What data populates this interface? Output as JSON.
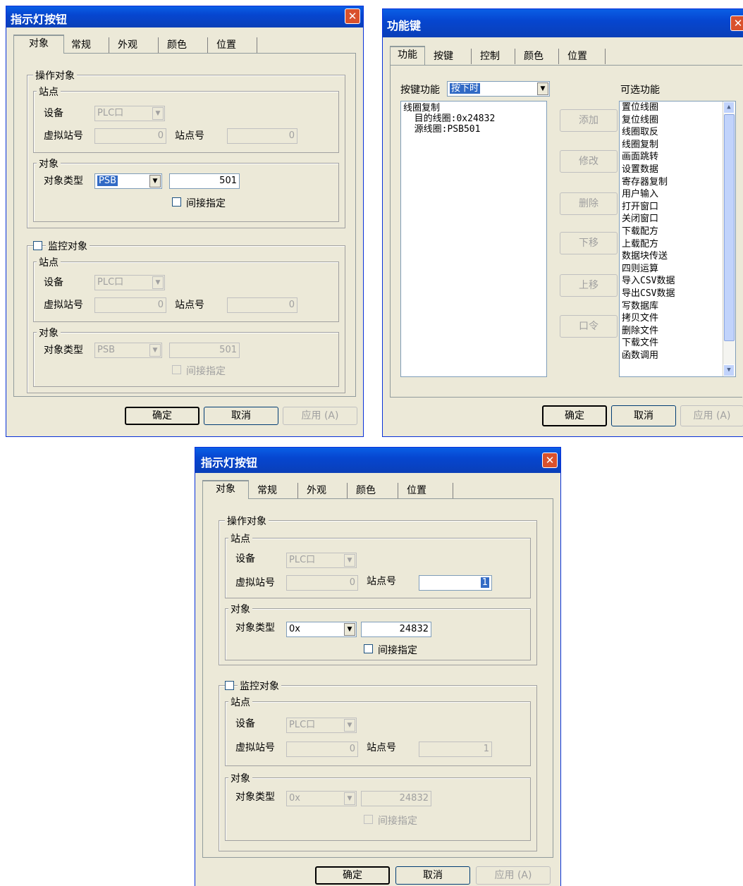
{
  "dialog1": {
    "title": "指示灯按钮",
    "close": "✕",
    "tabs": [
      "对象",
      "常规",
      "外观",
      "颜色",
      "位置"
    ],
    "operate": {
      "legend": "操作对象",
      "station_legend": "站点",
      "device_label": "设备",
      "device_value": "PLC口",
      "virtual_label": "虚拟站号",
      "virtual_value": "0",
      "station_label": "站点号",
      "station_value": "0",
      "object_legend": "对象",
      "type_label": "对象类型",
      "type_value": "PSB",
      "addr_value": "501",
      "indirect_label": "间接指定"
    },
    "monitor": {
      "legend": "监控对象",
      "station_legend": "站点",
      "device_label": "设备",
      "device_value": "PLC口",
      "virtual_label": "虚拟站号",
      "virtual_value": "0",
      "station_label": "站点号",
      "station_value": "0",
      "object_legend": "对象",
      "type_label": "对象类型",
      "type_value": "PSB",
      "addr_value": "501",
      "indirect_label": "间接指定"
    },
    "buttons": {
      "ok": "确定",
      "cancel": "取消",
      "apply": "应用 (A)"
    }
  },
  "dialog2": {
    "title": "功能键",
    "close": "✕",
    "tabs": [
      "功能",
      "按键",
      "控制",
      "颜色",
      "位置"
    ],
    "key_func_label": "按键功能",
    "key_func_value": "按下时",
    "config_list": [
      "线圈复制",
      "  目的线圈:0x24832",
      "  源线圈:PSB501"
    ],
    "side_buttons": [
      "添加",
      "修改",
      "删除",
      "下移",
      "上移",
      "口令"
    ],
    "available_label": "可选功能",
    "available_list": [
      "置位线圈",
      "复位线圈",
      "线圈取反",
      "线圈复制",
      "画面跳转",
      "设置数据",
      "寄存器复制",
      "用户输入",
      "打开窗口",
      "关闭窗口",
      "下载配方",
      "上载配方",
      "数据块传送",
      "四则运算",
      "导入CSV数据",
      "导出CSV数据",
      "写数据库",
      "拷贝文件",
      "删除文件",
      "下载文件",
      "函数调用"
    ],
    "buttons": {
      "ok": "确定",
      "cancel": "取消",
      "apply": "应用 (A)"
    }
  },
  "dialog3": {
    "title": "指示灯按钮",
    "close": "✕",
    "tabs": [
      "对象",
      "常规",
      "外观",
      "颜色",
      "位置"
    ],
    "operate": {
      "legend": "操作对象",
      "station_legend": "站点",
      "device_label": "设备",
      "device_value": "PLC口",
      "virtual_label": "虚拟站号",
      "virtual_value": "0",
      "station_label": "站点号",
      "station_value": "1",
      "object_legend": "对象",
      "type_label": "对象类型",
      "type_value": "0x",
      "addr_value": "24832",
      "indirect_label": "间接指定"
    },
    "monitor": {
      "legend": "监控对象",
      "station_legend": "站点",
      "device_label": "设备",
      "device_value": "PLC口",
      "virtual_label": "虚拟站号",
      "virtual_value": "0",
      "station_label": "站点号",
      "station_value": "1",
      "object_legend": "对象",
      "type_label": "对象类型",
      "type_value": "0x",
      "addr_value": "24832",
      "indirect_label": "间接指定"
    },
    "buttons": {
      "ok": "确定",
      "cancel": "取消",
      "apply": "应用 (A)"
    }
  }
}
